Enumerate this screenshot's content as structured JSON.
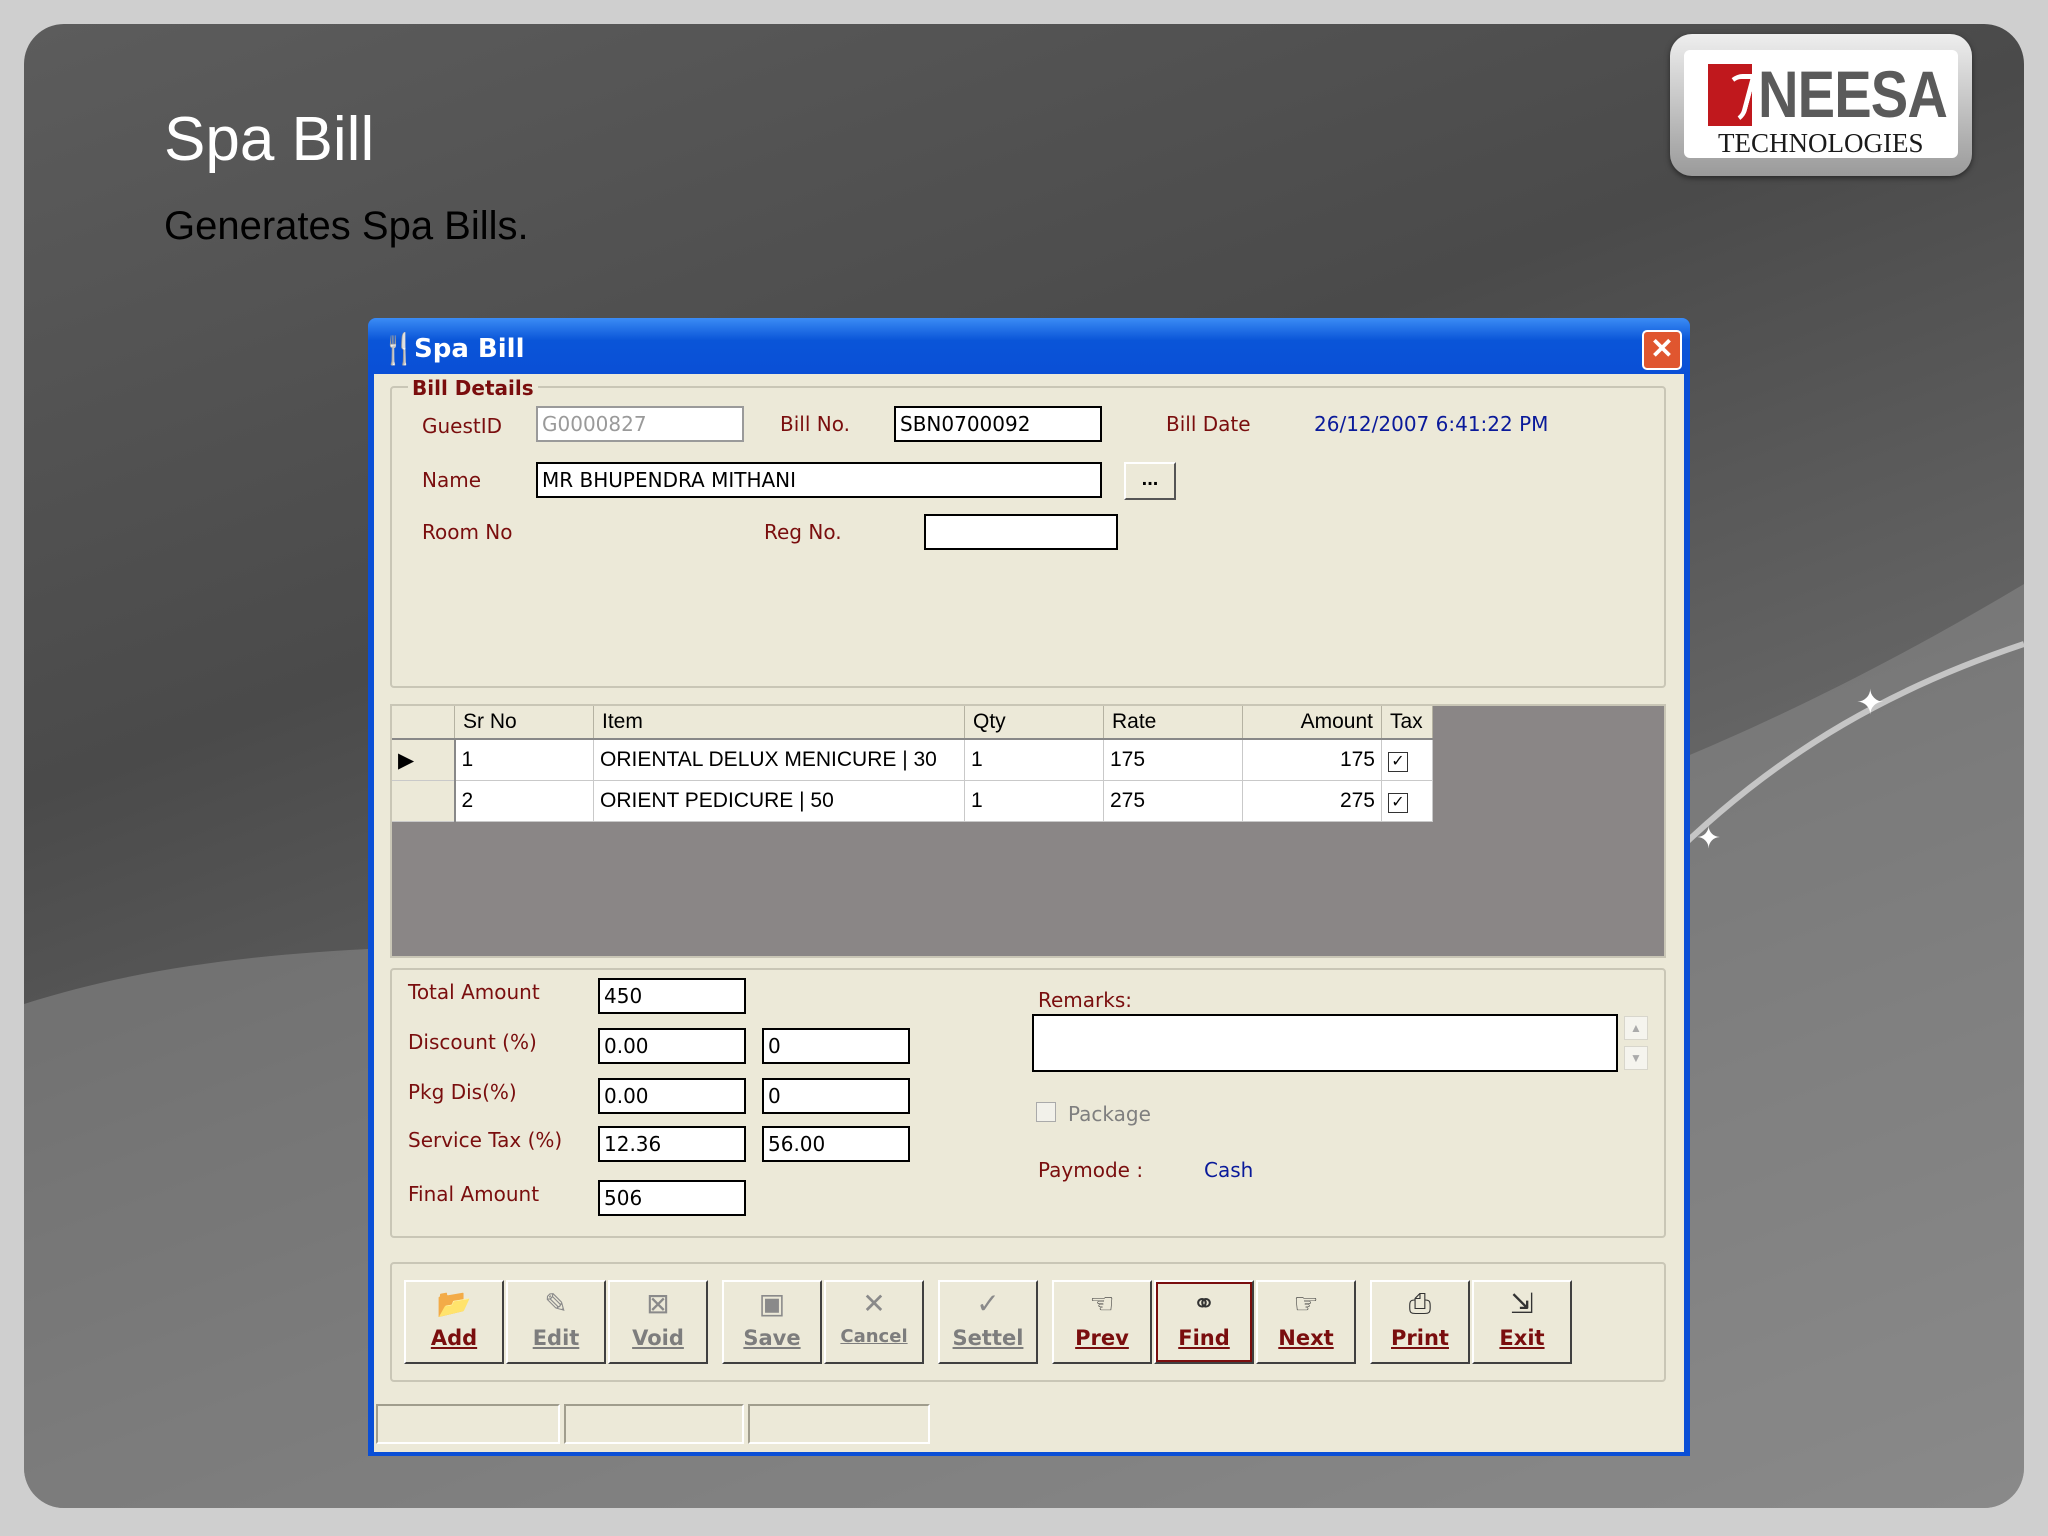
{
  "slide": {
    "title": "Spa Bill",
    "subtitle": "Generates Spa Bills."
  },
  "logo": {
    "name": "NEESA",
    "tagline": "TECHNOLOGIES",
    "brand_color": "#c0181d"
  },
  "window": {
    "title": "Spa Bill",
    "icon": "cutlery-icon",
    "titlebar_color": "#0a4fd6"
  },
  "bill_details": {
    "legend": "Bill Details",
    "guest_id_label": "GuestID",
    "guest_id_value": "G0000827",
    "bill_no_label": "Bill No.",
    "bill_no_value": "SBN0700092",
    "bill_date_label": "Bill Date",
    "bill_date_value": "26/12/2007 6:41:22 PM",
    "name_label": "Name",
    "name_value": "MR BHUPENDRA MITHANI",
    "browse_label": "...",
    "room_no_label": "Room No",
    "reg_no_label": "Reg No.",
    "reg_no_value": ""
  },
  "grid": {
    "columns": [
      "Sr No",
      "Item",
      "Qty",
      "Rate",
      "Amount",
      "Tax"
    ],
    "rows": [
      {
        "sr": "1",
        "item": "ORIENTAL DELUX MENICURE | 30",
        "qty": "1",
        "rate": "175",
        "amount": "175",
        "tax": true,
        "current": true
      },
      {
        "sr": "2",
        "item": "ORIENT PEDICURE | 50",
        "qty": "1",
        "rate": "275",
        "amount": "275",
        "tax": true,
        "current": false
      }
    ]
  },
  "totals": {
    "total_amount_label": "Total Amount",
    "total_amount": "450",
    "discount_label": "Discount (%)",
    "discount_pct": "0.00",
    "discount_amt": "0",
    "pkg_dis_label": "Pkg Dis(%)",
    "pkg_dis_pct": "0.00",
    "pkg_dis_amt": "0",
    "service_tax_label": "Service Tax (%)",
    "service_tax_pct": "12.36",
    "service_tax_amt": "56.00",
    "final_amount_label": "Final Amount",
    "final_amount": "506",
    "remarks_label": "Remarks:",
    "remarks_value": "",
    "package_label": "Package",
    "package_checked": false,
    "paymode_label": "Paymode :",
    "paymode_value": "Cash"
  },
  "toolbar": {
    "buttons": [
      {
        "label": "Add",
        "icon": "add-folder-icon",
        "enabled": true
      },
      {
        "label": "Edit",
        "icon": "edit-icon",
        "enabled": false
      },
      {
        "label": "Void",
        "icon": "void-icon",
        "enabled": false
      },
      {
        "label": "Save",
        "icon": "floppy-disk-icon",
        "enabled": false
      },
      {
        "label": "Cancel",
        "icon": "cancel-icon",
        "enabled": false
      },
      {
        "label": "Settel",
        "icon": "checkmark-icon",
        "enabled": false
      },
      {
        "label": "Prev",
        "icon": "hand-left-icon",
        "enabled": true
      },
      {
        "label": "Find",
        "icon": "binoculars-icon",
        "enabled": true
      },
      {
        "label": "Next",
        "icon": "hand-right-icon",
        "enabled": true
      },
      {
        "label": "Print",
        "icon": "printer-icon",
        "enabled": true
      },
      {
        "label": "Exit",
        "icon": "exit-door-icon",
        "enabled": true
      }
    ]
  }
}
